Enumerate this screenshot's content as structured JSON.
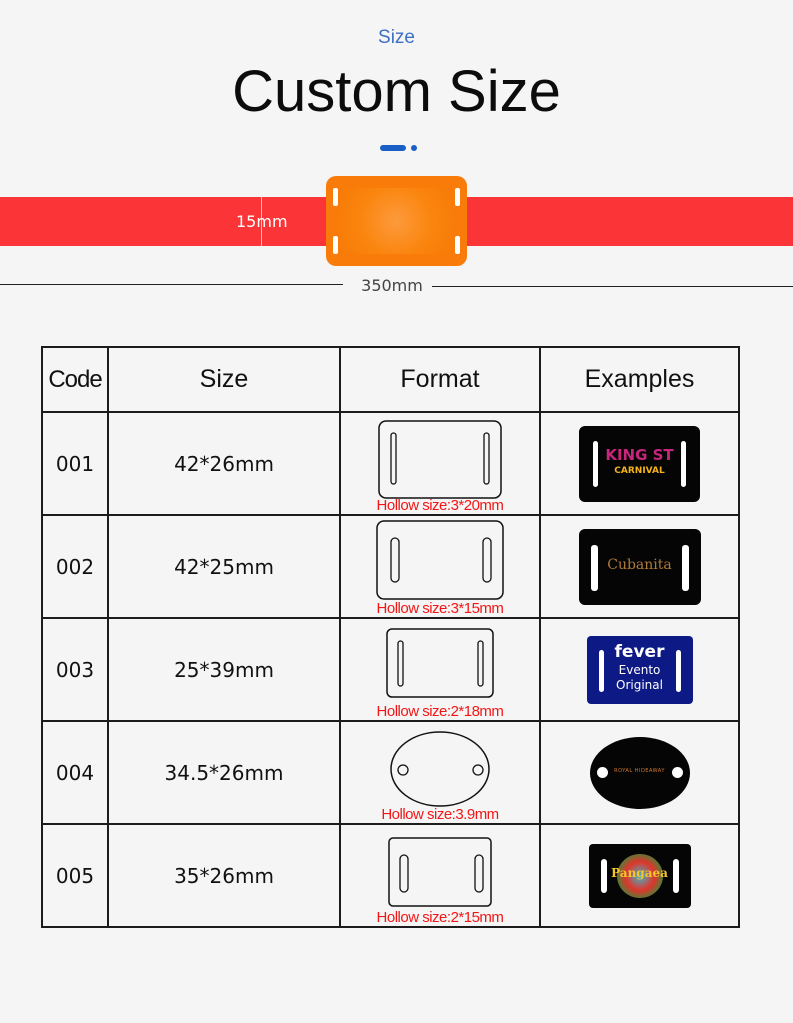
{
  "header": {
    "eyebrow": "Size",
    "title": "Custom Size"
  },
  "colors": {
    "accent": "#1a5fc6",
    "strap": "#fb3438",
    "buckle": "#f97c0a",
    "hollow_text": "#f41616"
  },
  "diagram": {
    "width_label": "15mm",
    "length_label": "350mm"
  },
  "table": {
    "headers": [
      "Code",
      "Size",
      "Format",
      "Examples"
    ],
    "rows": [
      {
        "code": "001",
        "size": "42*26mm",
        "format_shape": "rectangle-two-slots",
        "hollow": "Hollow size:3*20mm",
        "example": {
          "bg": "#050505",
          "text1": "KING ST",
          "text2": "CARNIVAL"
        }
      },
      {
        "code": "002",
        "size": "42*25mm",
        "format_shape": "rectangle-two-slots",
        "hollow": "Hollow size:3*15mm",
        "example": {
          "bg": "#050505",
          "text1": "Cubanita",
          "text2": ""
        }
      },
      {
        "code": "003",
        "size": "25*39mm",
        "format_shape": "rectangle-two-slots",
        "hollow": "Hollow size:2*18mm",
        "example": {
          "bg": "#0d1a86",
          "text1": "fever",
          "text2": "Evento",
          "text3": "Original"
        }
      },
      {
        "code": "004",
        "size": "34.5*26mm",
        "format_shape": "oval-two-holes",
        "hollow": "Hollow size:3.9mm",
        "example": {
          "bg": "#050505",
          "text1": "ROYAL HIDEAWAY",
          "text2": ""
        }
      },
      {
        "code": "005",
        "size": "35*26mm",
        "format_shape": "rectangle-two-slots",
        "hollow": "Hollow size:2*15mm",
        "example": {
          "bg": "#050505",
          "text1": "Pangaea",
          "text2": ""
        }
      }
    ]
  }
}
